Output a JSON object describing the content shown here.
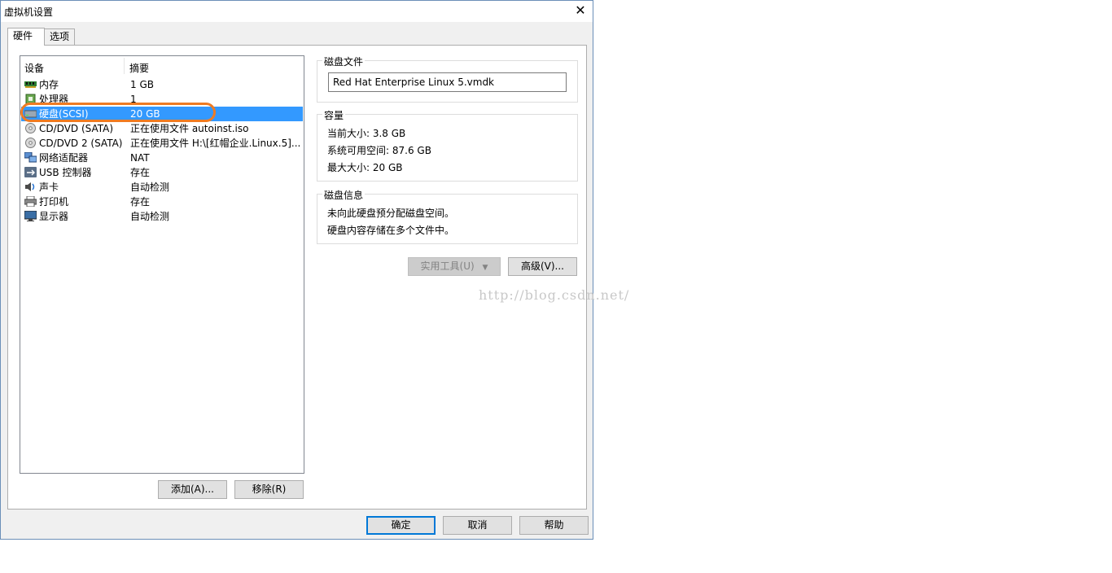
{
  "window": {
    "title": "虚拟机设置"
  },
  "tabs": [
    {
      "label": "硬件",
      "active": true
    },
    {
      "label": "选项",
      "active": false
    }
  ],
  "device_list": {
    "columns": [
      "设备",
      "摘要"
    ],
    "rows": [
      {
        "name": "内存",
        "summary": "1 GB",
        "icon": "memory-icon"
      },
      {
        "name": "处理器",
        "summary": "1",
        "icon": "processor-icon"
      },
      {
        "name": "硬盘(SCSI)",
        "summary": "20 GB",
        "icon": "hard-disk-icon",
        "selected": true
      },
      {
        "name": "CD/DVD (SATA)",
        "summary": "正在使用文件 autoinst.iso",
        "icon": "cd-dvd-icon"
      },
      {
        "name": "CD/DVD 2 (SATA)",
        "summary": "正在使用文件 H:\\[红帽企业.Linux.5]...",
        "icon": "cd-dvd-icon"
      },
      {
        "name": "网络适配器",
        "summary": "NAT",
        "icon": "network-adapter-icon"
      },
      {
        "name": "USB 控制器",
        "summary": "存在",
        "icon": "usb-icon"
      },
      {
        "name": "声卡",
        "summary": "自动检测",
        "icon": "sound-card-icon"
      },
      {
        "name": "打印机",
        "summary": "存在",
        "icon": "printer-icon"
      },
      {
        "name": "显示器",
        "summary": "自动检测",
        "icon": "display-icon"
      }
    ]
  },
  "buttons": {
    "add": "添加(A)...",
    "remove": "移除(R)",
    "utilities": "实用工具(U)",
    "advanced": "高级(V)...",
    "ok": "确定",
    "cancel": "取消",
    "help": "帮助"
  },
  "disk_file": {
    "label": "磁盘文件",
    "value": "Red Hat Enterprise Linux 5.vmdk"
  },
  "capacity": {
    "label": "容量",
    "current_size": "当前大小: 3.8 GB",
    "available_space": "系统可用空间: 87.6 GB",
    "max_size": "最大大小: 20 GB"
  },
  "disk_info": {
    "label": "磁盘信息",
    "line1": "未向此硬盘预分配磁盘空间。",
    "line2": "硬盘内容存储在多个文件中。"
  },
  "watermark": "http://blog.csdn.net/",
  "colors": {
    "selection": "#3399ff",
    "highlight": "#ef7b22",
    "accent": "#0078d7"
  }
}
